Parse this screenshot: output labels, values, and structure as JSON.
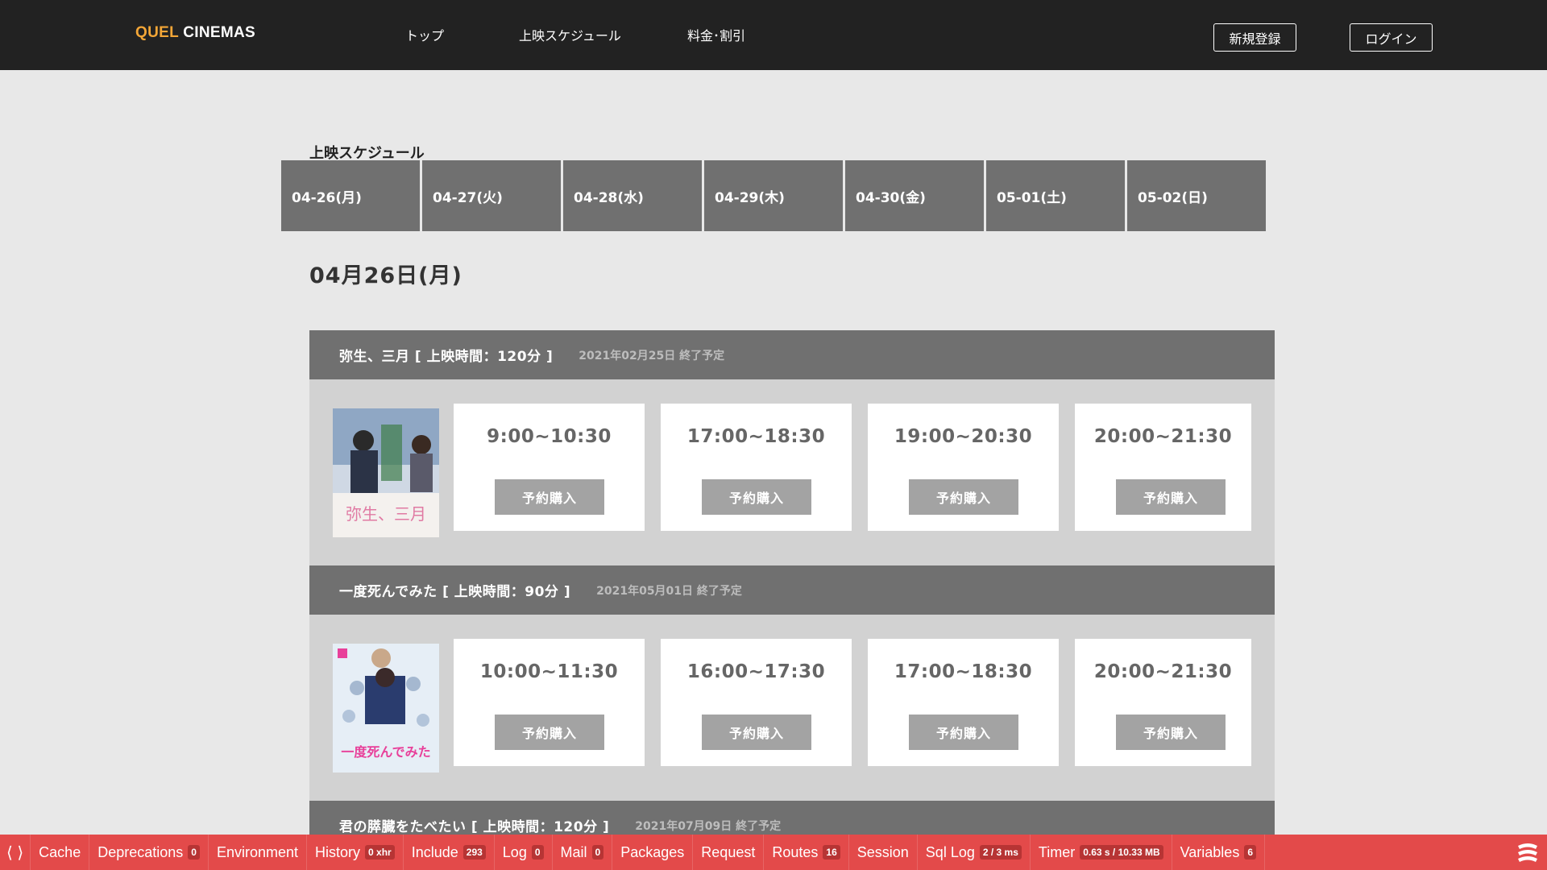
{
  "header": {
    "logo_part1": "QUEL",
    "logo_part2": "CINEMAS",
    "nav": [
      "トップ",
      "上映スケジュール",
      "料金･割引"
    ],
    "register_label": "新規登録",
    "login_label": "ログイン"
  },
  "schedule": {
    "section_title": "上映スケジュール",
    "tabs": [
      "04-26(月)",
      "04-27(火)",
      "04-28(水)",
      "04-29(木)",
      "04-30(金)",
      "05-01(土)",
      "05-02(日)"
    ],
    "date_heading": "04月26日(月)",
    "movies": [
      {
        "title": "弥生、三月 [ 上映時間：120分 ]",
        "end_note": "2021年02月25日 終了予定",
        "poster_text": "弥生、三月",
        "times": [
          "9:00~10:30",
          "17:00~18:30",
          "19:00~20:30",
          "20:00~21:30"
        ]
      },
      {
        "title": "一度死んでみた [ 上映時間：90分 ]",
        "end_note": "2021年05月01日 終了予定",
        "poster_text": "一度死んでみた",
        "times": [
          "10:00~11:30",
          "16:00~17:30",
          "17:00~18:30",
          "20:00~21:30"
        ]
      },
      {
        "title": "君の膵臓をたべたい [ 上映時間：120分 ]",
        "end_note": "2021年07月09日 終了予定"
      }
    ],
    "reserve_label": "予約購入"
  },
  "debugbar": {
    "items": [
      {
        "label": "Cache"
      },
      {
        "label": "Deprecations",
        "badge": "0"
      },
      {
        "label": "Environment"
      },
      {
        "label": "History",
        "badge": "0 xhr"
      },
      {
        "label": "Include",
        "badge": "293"
      },
      {
        "label": "Log",
        "badge": "0"
      },
      {
        "label": "Mail",
        "badge": "0"
      },
      {
        "label": "Packages"
      },
      {
        "label": "Request"
      },
      {
        "label": "Routes",
        "badge": "16"
      },
      {
        "label": "Session"
      },
      {
        "label": "Sql Log",
        "badge": "2 / 3 ms"
      },
      {
        "label": "Timer",
        "badge": "0.63 s / 10.33 MB"
      },
      {
        "label": "Variables",
        "badge": "6"
      }
    ]
  },
  "colors": {
    "header_bg": "#222222",
    "logo_accent": "#f3a637",
    "tab_bg": "#707070",
    "debug_bar": "#e34a4a"
  }
}
